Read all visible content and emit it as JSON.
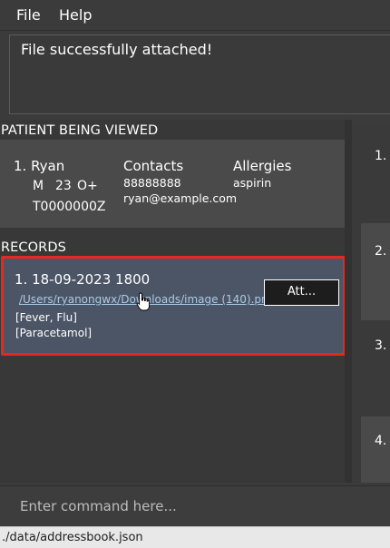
{
  "menu": {
    "file": "File",
    "help": "Help"
  },
  "result_display": {
    "message": "File successfully attached!"
  },
  "patient_panel": {
    "header": "PATIENT BEING VIEWED",
    "patient": {
      "index_name": "1. Ryan",
      "gender": "M",
      "age": "23",
      "blood_type": "O+",
      "nric": "T0000000Z",
      "contacts_label": "Contacts",
      "phone": "88888888",
      "email": "ryan@example.com",
      "allergies_label": "Allergies",
      "allergies": "aspirin"
    }
  },
  "records_panel": {
    "header": "RECORDS",
    "records": [
      {
        "title": "1. 18-09-2023 1800",
        "attachment": "/Users/ryanongwx/Downloads/image (140).png",
        "conditions": "[Fever, Flu]",
        "medications": "[Paracetamol]",
        "attach_button": "Att..."
      }
    ]
  },
  "right_list": {
    "items": [
      "1.",
      "2.",
      "3.",
      "4."
    ]
  },
  "command": {
    "placeholder": "Enter command here..."
  },
  "status_bar": {
    "path": "./data/addressbook.json"
  },
  "colors": {
    "record_highlight": "#e8271e",
    "link": "#a9cbe8"
  }
}
